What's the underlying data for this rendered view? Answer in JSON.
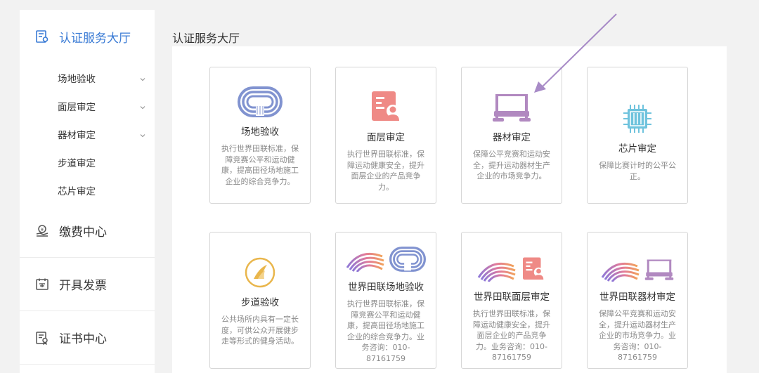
{
  "sidebar": {
    "hall_label": "认证服务大厅",
    "sub_items": [
      {
        "label": "场地验收",
        "expandable": true
      },
      {
        "label": "面层审定",
        "expandable": true
      },
      {
        "label": "器材审定",
        "expandable": true
      },
      {
        "label": "步道审定",
        "expandable": false
      },
      {
        "label": "芯片审定",
        "expandable": false
      }
    ],
    "payment_label": "缴费中心",
    "invoice_label": "开具发票",
    "certificate_label": "证书中心"
  },
  "main": {
    "title": "认证服务大厅",
    "cards": [
      {
        "title": "场地验收",
        "desc": "执行世界田联标准，保障竞赛公平和运动健康，提高田径场地施工企业的综合竞争力。",
        "icons": [
          "track-icon"
        ]
      },
      {
        "title": "面层审定",
        "desc": "执行世界田联标准，保障运动健康安全，提升面层企业的产品竞争力。",
        "icons": [
          "document-person-icon"
        ]
      },
      {
        "title": "器材审定",
        "desc": "保障公平竞赛和运动安全，提升运动器材生产企业的市场竞争力。",
        "icons": [
          "hurdle-icon"
        ]
      },
      {
        "title": "芯片审定",
        "desc": "保障比赛计时的公平公正。",
        "icons": [
          "chip-icon"
        ]
      },
      {
        "title": "步道验收",
        "desc": "公共场所内具有一定长度，可供公众开展健步走等形式的健身活动。",
        "icons": [
          "trail-icon"
        ]
      },
      {
        "title": "世界田联场地验收",
        "desc": "执行世界田联标准，保障竞赛公平和运动健康，提高田径场地施工企业的综合竞争力。业务咨询：010-87161759",
        "icons": [
          "world-athletics-logo-icon",
          "track-icon"
        ]
      },
      {
        "title": "世界田联面层审定",
        "desc": "执行世界田联标准，保障运动健康安全，提升面层企业的产品竞争力。业务咨询：010-87161759",
        "icons": [
          "world-athletics-logo-icon",
          "document-person-icon"
        ]
      },
      {
        "title": "世界田联器材审定",
        "desc": "保障公平竞赛和运动安全，提升运动器材生产企业的市场竞争力。业务咨询：010-87161759",
        "icons": [
          "world-athletics-logo-icon",
          "hurdle-icon"
        ]
      }
    ]
  },
  "colors": {
    "accent": "#3a7bd5",
    "track": "#8193d0",
    "document": "#ef8a86",
    "hurdle": "#b189c0",
    "chip": "#6fc3dd",
    "trail": "#e9b64c",
    "annotation_arrow": "#a88bc7"
  }
}
